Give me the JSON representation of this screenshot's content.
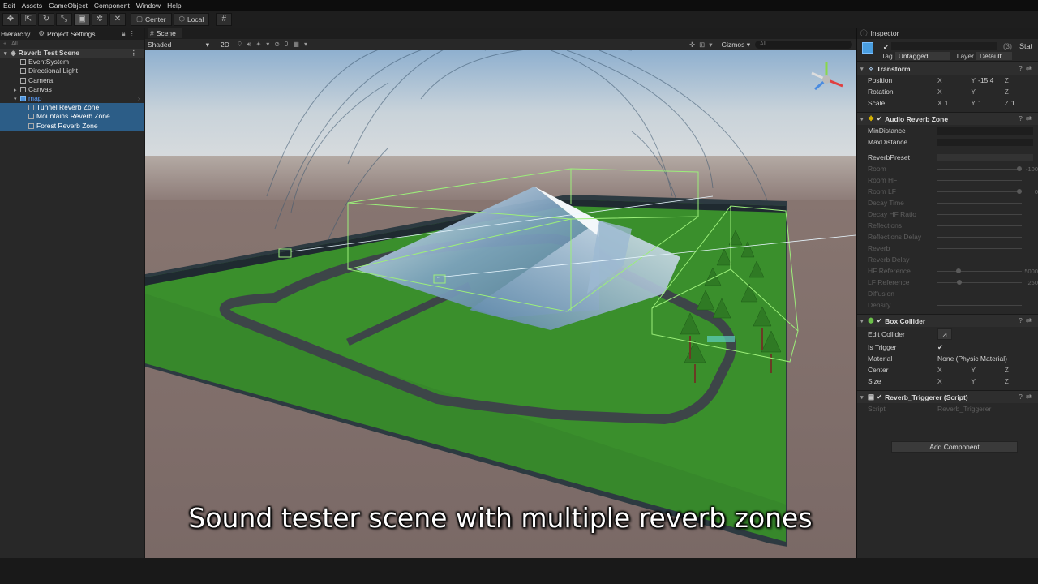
{
  "menu": [
    "Edit",
    "Assets",
    "GameObject",
    "Component",
    "Window",
    "Help"
  ],
  "toolbar": {
    "pivot_label": "Center",
    "space_label": "Local"
  },
  "hierarchy": {
    "tab_label": "Hierarchy",
    "settings_tab_label": "Project Settings",
    "search_placeholder": "All",
    "scene_name": "Reverb Test Scene",
    "items": [
      {
        "label": "EventSystem"
      },
      {
        "label": "Directional Light"
      },
      {
        "label": "Camera"
      },
      {
        "label": "Canvas"
      },
      {
        "label": "map"
      },
      {
        "label": "Tunnel Reverb Zone"
      },
      {
        "label": "Mountains Reverb Zone"
      },
      {
        "label": "Forest Reverb Zone"
      }
    ]
  },
  "scene": {
    "tab_label": "Scene",
    "shading_mode": "Shaded",
    "mode_2d": "2D",
    "gizmos_label": "Gizmos",
    "search_placeholder": "All",
    "caption": "Sound tester scene with multiple reverb zones"
  },
  "inspector": {
    "tab_label": "Inspector",
    "object_count": "(3)",
    "static_label": "Stat",
    "tag_label": "Tag",
    "tag_value": "Untagged",
    "layer_label": "Layer",
    "layer_value": "Default",
    "transform": {
      "title": "Transform",
      "position_label": "Position",
      "rotation_label": "Rotation",
      "scale_label": "Scale",
      "position": {
        "x": "",
        "y": "-15.4",
        "z": ""
      },
      "rotation": {
        "x": "",
        "y": "",
        "z": ""
      },
      "scale": {
        "x": "1",
        "y": "1",
        "z": "1"
      }
    },
    "audio_reverb": {
      "title": "Audio Reverb Zone",
      "min_distance_label": "MinDistance",
      "max_distance_label": "MaxDistance",
      "preset_label": "ReverbPreset",
      "room_label": "Room",
      "room_value": "-100",
      "room_hf_label": "Room HF",
      "room_lf_label": "Room LF",
      "room_lf_value": "0",
      "decay_time_label": "Decay Time",
      "decay_hf_label": "Decay HF Ratio",
      "reflections_label": "Reflections",
      "reflections_delay_label": "Reflections Delay",
      "reverb_label": "Reverb",
      "reverb_delay_label": "Reverb Delay",
      "hf_ref_label": "HF Reference",
      "hf_ref_value": "5000",
      "lf_ref_label": "LF Reference",
      "lf_ref_value": "250",
      "diffusion_label": "Diffusion",
      "density_label": "Density"
    },
    "box_collider": {
      "title": "Box Collider",
      "edit_label": "Edit Collider",
      "trigger_label": "Is Trigger",
      "material_label": "Material",
      "material_value": "None (Physic Material)",
      "center_label": "Center",
      "size_label": "Size"
    },
    "script": {
      "title": "Reverb_Triggerer (Script)",
      "script_label": "Script",
      "script_value": "Reverb_Triggerer"
    },
    "add_component_label": "Add Component"
  },
  "colors": {
    "selection": "#2c5d87",
    "ground": "#3a8f2c",
    "gizmo_green": "#9cef7a"
  }
}
